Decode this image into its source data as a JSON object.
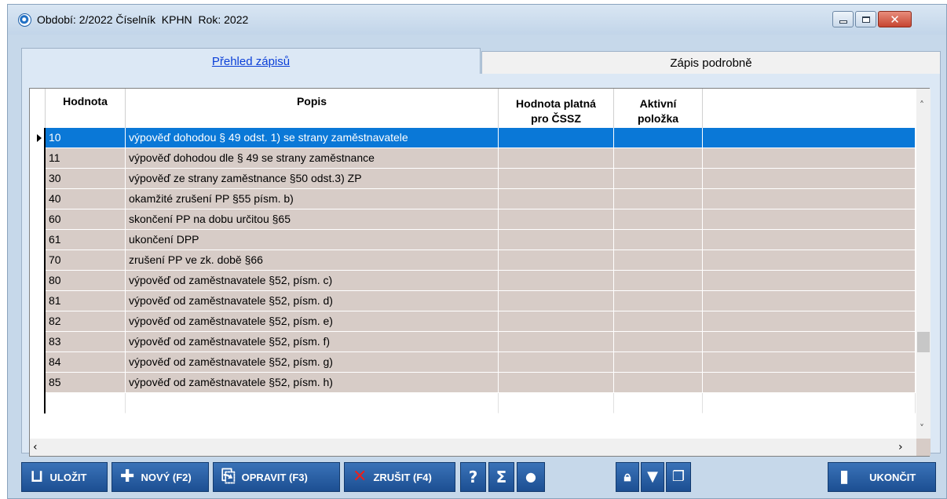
{
  "window": {
    "title": "Období: 2/2022 Číselník  KPHN  Rok: 2022",
    "controls": [
      "minimize",
      "maximize",
      "close"
    ]
  },
  "tabs": [
    {
      "label": "Přehled zápisů",
      "active": true
    },
    {
      "label": "Zápis podrobně",
      "active": false
    }
  ],
  "table": {
    "columns": [
      "Hodnota",
      "Popis",
      "Hodnota platná pro ČSSZ",
      "Aktivní položka",
      ""
    ],
    "header_lines": {
      "c3a": "Hodnota platná",
      "c3b": "pro ČSSZ",
      "c4a": "Aktivní",
      "c4b": "položka"
    },
    "rows": [
      {
        "hodnota": "10",
        "popis": "výpověď dohodou § 49 odst. 1) se strany zaměstnavatele",
        "selected": true
      },
      {
        "hodnota": "11",
        "popis": "výpověď dohodou dle § 49 se strany zaměstnance"
      },
      {
        "hodnota": "30",
        "popis": "výpověď ze strany zaměstnance §50 odst.3) ZP"
      },
      {
        "hodnota": "40",
        "popis": "okamžité zrušení PP §55 písm. b)"
      },
      {
        "hodnota": "60",
        "popis": "skončení PP na dobu určitou §65"
      },
      {
        "hodnota": "61",
        "popis": "ukončení DPP"
      },
      {
        "hodnota": "70",
        "popis": "zrušení PP ve zk. době §66"
      },
      {
        "hodnota": "80",
        "popis": "výpověď od zaměstnavatele §52, písm. c)"
      },
      {
        "hodnota": "81",
        "popis": "výpověď od zaměstnavatele §52, písm. d)"
      },
      {
        "hodnota": "82",
        "popis": "výpověď od zaměstnavatele §52, písm. e)"
      },
      {
        "hodnota": "83",
        "popis": "výpověď od zaměstnavatele §52, písm. f)"
      },
      {
        "hodnota": "84",
        "popis": "výpověď od zaměstnavatele §52, písm. g)"
      },
      {
        "hodnota": "85",
        "popis": "výpověď od zaměstnavatele §52, písm. h)"
      }
    ]
  },
  "toolbar": {
    "save": "ULOŽIT",
    "new": "NOVÝ (F2)",
    "edit": "OPRAVIT (F3)",
    "cancel": "ZRUŠIT (F4)",
    "help_icon": "?",
    "sum_icon": "Σ",
    "exit": "UKONČIT"
  },
  "colors": {
    "row_bg": "#d7ccc7",
    "selected_bg": "#0a78d7",
    "toolbar_bg": "#2a62a6",
    "active_tab_text": "#0b3fd8"
  }
}
